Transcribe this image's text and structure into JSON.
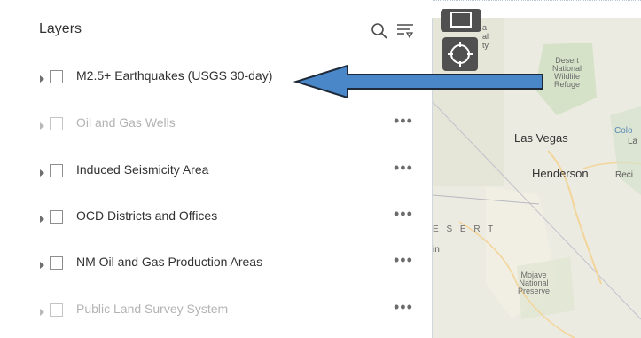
{
  "panel": {
    "title": "Layers",
    "search_icon": "search-icon",
    "filter_icon": "filter-icon"
  },
  "layers": [
    {
      "label": "M2.5+ Earthquakes (USGS 30-day)",
      "checked": false,
      "dimmed": false,
      "has_more": false
    },
    {
      "label": "Oil and Gas Wells",
      "checked": false,
      "dimmed": true,
      "has_more": true
    },
    {
      "label": "Induced Seismicity Area",
      "checked": false,
      "dimmed": false,
      "has_more": true
    },
    {
      "label": "OCD Districts and Offices",
      "checked": false,
      "dimmed": false,
      "has_more": true
    },
    {
      "label": "NM Oil and Gas Production Areas",
      "checked": false,
      "dimmed": false,
      "has_more": true
    },
    {
      "label": "Public Land Survey System",
      "checked": false,
      "dimmed": true,
      "has_more": true
    }
  ],
  "more_glyph": "•••",
  "map": {
    "labels": {
      "desert_refuge": "Desert\nNational\nWildlife\nRefuge",
      "las_vegas": "Las Vegas",
      "henderson": "Henderson",
      "mojave": "Mojave\nNational\nPreserve",
      "desert_word": "E S E R T",
      "in_word": "in",
      "colo": "Colo",
      "la": "La",
      "rec": "Reci",
      "a_top": "a",
      "al_top": "al",
      "ty_top": "ty"
    }
  },
  "colors": {
    "arrow_fill": "#4a87c8",
    "arrow_stroke": "#1e2a3a",
    "map_button": "#505050"
  }
}
